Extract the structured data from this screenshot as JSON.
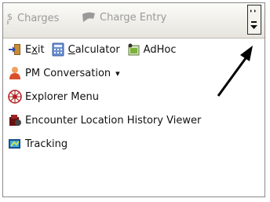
{
  "toolbar": {
    "charges": {
      "icon": "dollar-icon",
      "label": "Charges"
    },
    "charge_entry": {
      "icon": "charge-entry-icon",
      "label": "Charge Entry"
    },
    "overflow": {
      "icon": "toolbar-overflow-icon"
    }
  },
  "menu": {
    "exit": {
      "icon": "exit-door-icon",
      "pre": "E",
      "mnemonic": "x",
      "post": "it"
    },
    "calculator": {
      "icon": "calculator-icon",
      "mnemonic": "C",
      "post": "alculator"
    },
    "adhoc": {
      "icon": "adhoc-icon",
      "label": "AdHoc"
    },
    "pm_conversation": {
      "icon": "person-icon",
      "label": "PM Conversation",
      "dropdown": "▾"
    },
    "explorer_menu": {
      "icon": "explorer-menu-icon",
      "label": "Explorer Menu"
    },
    "encounter_location": {
      "icon": "encounter-location-icon",
      "label": "Encounter Location History Viewer"
    },
    "tracking": {
      "icon": "tracking-icon",
      "label": "Tracking"
    }
  },
  "colors": {
    "disabled_text": "#9a9a9a",
    "toolbar_bg": "#e6e4dd",
    "arrow": "#000000"
  }
}
